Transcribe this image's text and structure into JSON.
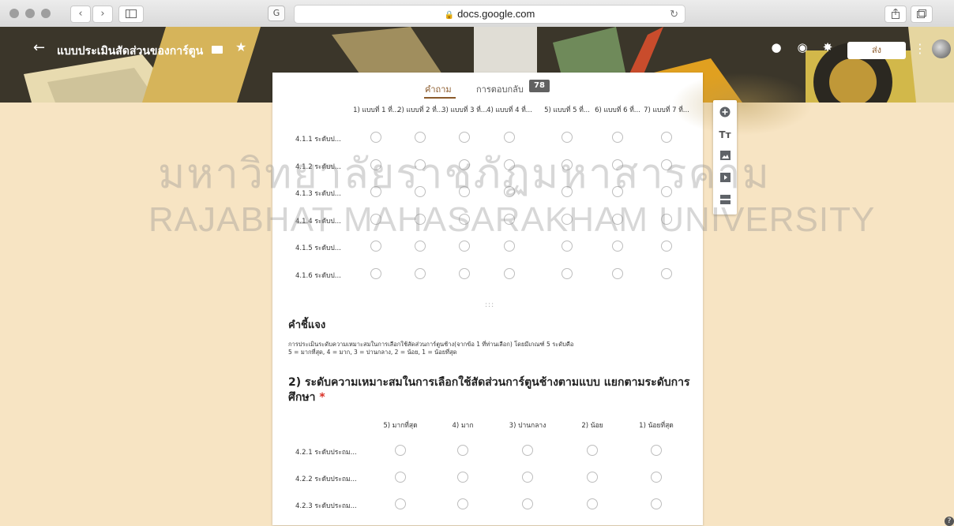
{
  "browser": {
    "url": "docs.google.com",
    "nav_back": "‹",
    "nav_forward": "›"
  },
  "header": {
    "back_icon": "arrow-left-icon",
    "title": "แบบประเมินสัดส่วนของการ์ตูน",
    "send_label": "ส่ง",
    "icons": [
      "palette-icon",
      "eye-icon",
      "gear-icon",
      "more-vert-icon"
    ]
  },
  "tabs": {
    "questions": "คำถาม",
    "responses": "การตอบกลับ",
    "responses_count": "78"
  },
  "grid1": {
    "columns": [
      "1) แบบที่ 1 ที่...",
      "2) แบบที่ 2 ที่...",
      "3) แบบที่ 3 ที่...",
      "4) แบบที่ 4 ที่...",
      "5) แบบที่ 5 ที่...",
      "6) แบบที่ 6 ที่...",
      "7) แบบที่ 7 ที่..."
    ],
    "rows": [
      "4.1.1 ระดับป...",
      "4.1.2 ระดับป...",
      "4.1.3 ระดับป...",
      "4.1.4 ระดับป...",
      "4.1.5 ระดับป...",
      "4.1.6 ระดับป..."
    ]
  },
  "section": {
    "drag_handle": ":::",
    "title": "คำชี้แจง",
    "description_line1": "การประเมินระดับความเหมาะสมในการเลือกใช้สัดส่วนการ์ตูนช้าง(จากข้อ 1 ที่ท่านเลือก) โดยมีเกณฑ์ 5 ระดับคือ",
    "description_line2": "5 = มากที่สุด, 4 = มาก, 3 = ปานกลาง, 2 = น้อย, 1 = น้อยที่สุด"
  },
  "question2": {
    "title": "2) ระดับความเหมาะสมในการเลือกใช้สัดส่วนการ์ตูนช้างตามแบบ แยกตามระดับการ ศึกษา",
    "required_mark": "*",
    "columns": [
      "5) มากที่สุด",
      "4) มาก",
      "3) ปานกลาง",
      "2) น้อย",
      "1) น้อยที่สุด"
    ],
    "rows": [
      "4.2.1 ระดับประถม...",
      "4.2.2 ระดับประถม...",
      "4.2.3 ระดับประถม..."
    ]
  },
  "toolbar": {
    "items": [
      "add-circle-icon",
      "title-icon",
      "image-icon",
      "video-icon",
      "section-icon"
    ],
    "title_glyph": "Tт"
  },
  "watermark": {
    "line1": "มหาวิทยาลัยราชภัฏมหาสารคาม",
    "line2": "RAJABHAT MAHASARAKHAM UNIVERSITY"
  },
  "help_label": "?"
}
